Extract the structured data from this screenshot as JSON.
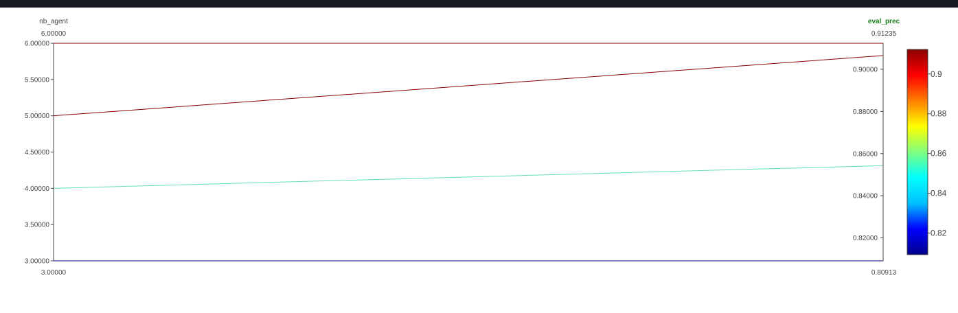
{
  "chart_data": {
    "type": "parcoords",
    "dimensions": [
      {
        "label": "nb_agent",
        "label_color": "#444444",
        "range": [
          3.0,
          6.0
        ],
        "top_label": "6.00000",
        "bottom_label": "3.00000",
        "ticks": [
          {
            "value": 6.0,
            "label": "6.00000"
          },
          {
            "value": 5.5,
            "label": "5.50000"
          },
          {
            "value": 5.0,
            "label": "5.00000"
          },
          {
            "value": 4.5,
            "label": "4.50000"
          },
          {
            "value": 4.0,
            "label": "4.00000"
          },
          {
            "value": 3.5,
            "label": "3.50000"
          },
          {
            "value": 3.0,
            "label": "3.00000"
          }
        ]
      },
      {
        "label": "eval_prec",
        "label_color": "#1a7f1a",
        "range": [
          0.80913,
          0.91235
        ],
        "top_label": "0.91235",
        "bottom_label": "0.80913",
        "ticks": [
          {
            "value": 0.9,
            "label": "0.90000"
          },
          {
            "value": 0.88,
            "label": "0.88000"
          },
          {
            "value": 0.86,
            "label": "0.86000"
          },
          {
            "value": 0.84,
            "label": "0.84000"
          },
          {
            "value": 0.82,
            "label": "0.82000"
          }
        ]
      }
    ],
    "lines": [
      {
        "nb_agent": 6,
        "eval_prec": 0.91235,
        "color": "#8b0000"
      },
      {
        "nb_agent": 5,
        "eval_prec": 0.9065,
        "color": "#8b0000"
      },
      {
        "nb_agent": 4,
        "eval_prec": 0.8543,
        "color": "#66dfb0"
      },
      {
        "nb_agent": 3,
        "eval_prec": 0.80913,
        "color": "#000080"
      }
    ],
    "colorbar": {
      "colorscale": [
        "#00008b",
        "#0000ff",
        "#00bfff",
        "#00ffff",
        "#7fff7f",
        "#ffff00",
        "#ff7f00",
        "#ff0000",
        "#8b0000"
      ],
      "range": [
        0.80913,
        0.91235
      ],
      "ticks": [
        {
          "value": 0.9,
          "label": "0.9"
        },
        {
          "value": 0.88,
          "label": "0.88"
        },
        {
          "value": 0.86,
          "label": "0.86"
        },
        {
          "value": 0.84,
          "label": "0.84"
        },
        {
          "value": 0.82,
          "label": "0.82"
        }
      ]
    }
  }
}
